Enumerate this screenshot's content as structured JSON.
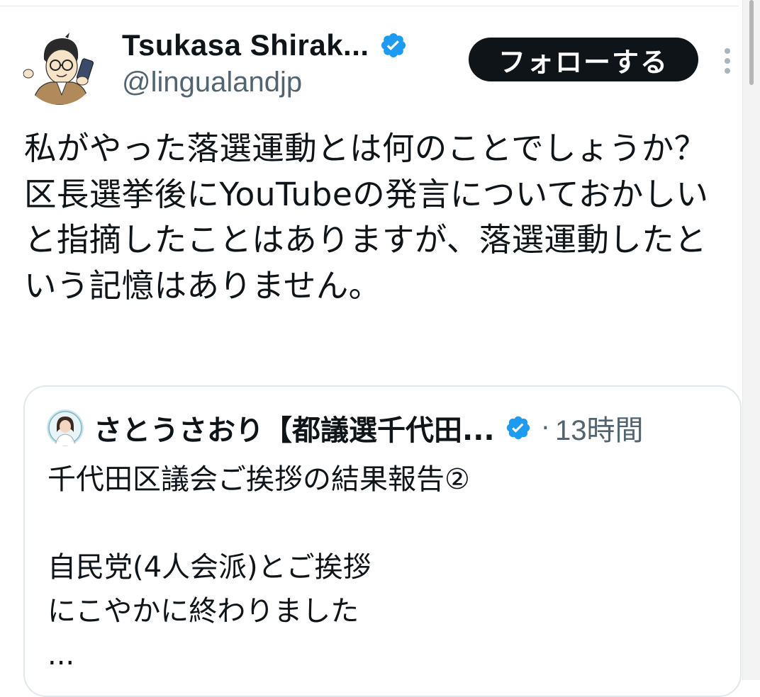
{
  "author": {
    "display_name": "Tsukasa Shirak...",
    "handle": "@lingualandjp",
    "verified": true
  },
  "follow_button": {
    "label": "フォローする"
  },
  "more_button": {
    "icon": "more-vertical-icon"
  },
  "tweet": {
    "text": "私がやった落選運動とは何のことでしょうか？　区長選挙後にYouTubeの発言についておかしいと指摘したことはありますが、落選運動したという記憶はありません。"
  },
  "quoted_tweet": {
    "author_name": "さとうさおり【都議選千代田...",
    "verified": true,
    "separator": "·",
    "time": "13時間",
    "text_lines": [
      "千代田区議会ご挨拶の結果報告②",
      "",
      "自民党(4人会派)とご挨拶",
      "にこやかに終わりました",
      "..."
    ]
  },
  "colors": {
    "primary_text": "#0f1419",
    "secondary_text": "#536471",
    "verified_blue": "#1d9bf0",
    "follow_button_bg": "#0f1419",
    "border": "#e3e7ea"
  }
}
